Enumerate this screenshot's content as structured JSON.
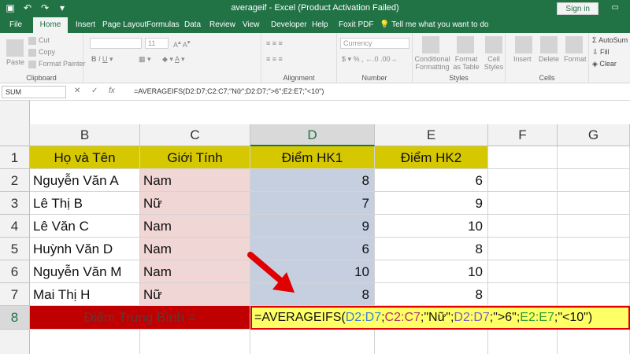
{
  "window": {
    "title": "averageif  -  Excel (Product Activation Failed)",
    "signin": "Sign in"
  },
  "tabs": [
    "File",
    "Home",
    "Insert",
    "Page Layout",
    "Formulas",
    "Data",
    "Review",
    "View",
    "Developer",
    "Help",
    "Foxit PDF"
  ],
  "tell_me": "Tell me what you want to do",
  "ribbon": {
    "clipboard": {
      "label": "Clipboard",
      "paste": "Paste",
      "cut": "Cut",
      "copy": "Copy",
      "format_painter": "Format Painter"
    },
    "font": {
      "font_size": "11"
    },
    "alignment": {
      "label": "Alignment",
      "wrap": "Wrap Text",
      "merge": "Merge & Center"
    },
    "number": {
      "label": "Number",
      "format": "Currency"
    },
    "styles": {
      "label": "Styles",
      "conditional": "Conditional Formatting",
      "format_table": "Format as Table",
      "cell_styles": "Cell Styles"
    },
    "cells": {
      "label": "Cells",
      "insert": "Insert",
      "delete": "Delete",
      "format": "Format"
    },
    "editing": {
      "autosum": "AutoSum",
      "fill": "Fill",
      "clear": "Clear"
    }
  },
  "formula_bar": {
    "name_box": "SUM",
    "formula": "=AVERAGEIFS(D2:D7;C2:C7;\"Nữ\";D2:D7;\">6\";E2:E7;\"<10\")"
  },
  "columns": [
    "B",
    "C",
    "D",
    "E",
    "F",
    "G"
  ],
  "rows": [
    "1",
    "2",
    "3",
    "4",
    "5",
    "6",
    "7",
    "8"
  ],
  "headers": {
    "name": "Họ và Tên",
    "gender": "Giới Tính",
    "hk1": "Điểm HK1",
    "hk2": "Điểm HK2"
  },
  "students": [
    {
      "name": "Nguyễn Văn A",
      "gender": "Nam",
      "hk1": "8",
      "hk2": "6"
    },
    {
      "name": "Lê Thị B",
      "gender": "Nữ",
      "hk1": "7",
      "hk2": "9"
    },
    {
      "name": "Lê Văn C",
      "gender": "Nam",
      "hk1": "9",
      "hk2": "10"
    },
    {
      "name": "Huỳnh Văn D",
      "gender": "Nam",
      "hk1": "6",
      "hk2": "8"
    },
    {
      "name": "Nguyễn Văn M",
      "gender": "Nam",
      "hk1": "10",
      "hk2": "10"
    },
    {
      "name": "Mai Thị H",
      "gender": "Nữ",
      "hk1": "8",
      "hk2": "8"
    }
  ],
  "average_label": "Điểm Trung Bình =",
  "formula_cell": {
    "fn": "=AVERAGEIFS(",
    "a1": "D2:D7",
    "s1": ";",
    "a2": "C2:C7",
    "s2": ";\"Nữ\";",
    "a3": "D2:D7",
    "s3": ";\">6\";",
    "a4": "E2:E7",
    "s4": ";\"<10\")"
  },
  "colors": {
    "excel_green": "#217346",
    "header_fill": "#d6c800",
    "avg_fill": "#c00000",
    "formula_fill": "#ffff66",
    "arrow": "#e00000"
  }
}
